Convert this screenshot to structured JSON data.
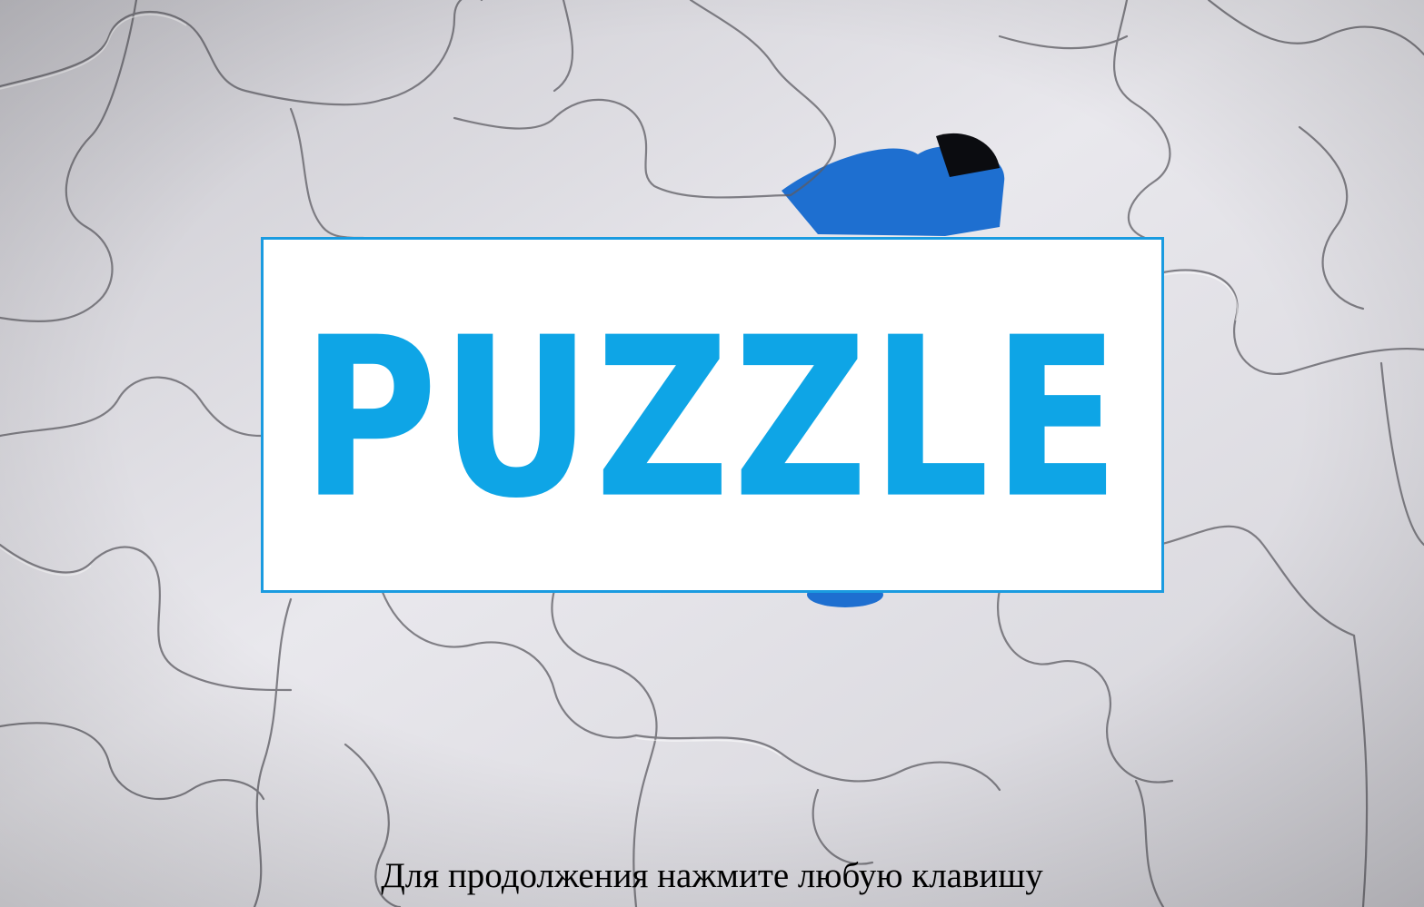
{
  "title": {
    "text": "PUZZLE",
    "color": "#0ea5e6",
    "border_color": "#1a9be0",
    "background_color": "#ffffff"
  },
  "prompt": {
    "text": "Для продолжения нажмите любую клавишу",
    "color": "#000000"
  },
  "background": {
    "description_icon": "jigsaw-puzzle-background",
    "piece_color": "#e6e5ea",
    "gap_color": "#1e6fd0"
  }
}
